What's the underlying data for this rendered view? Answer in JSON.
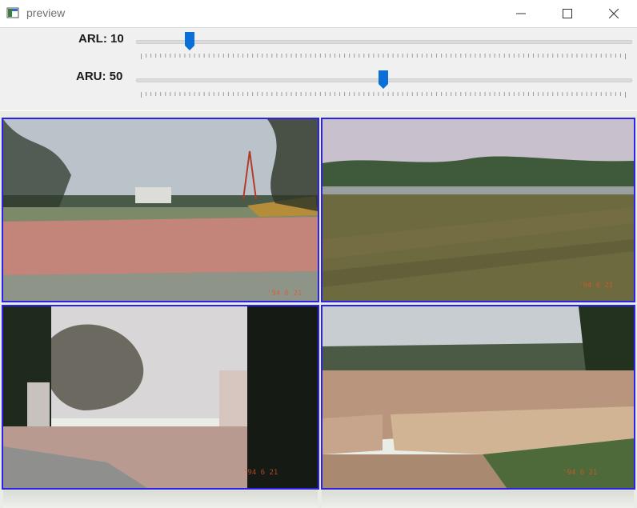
{
  "window": {
    "title": "preview"
  },
  "trackbars": [
    {
      "label": "ARL: 10",
      "value": 10,
      "max": 100
    },
    {
      "label": "ARU: 50",
      "value": 50,
      "max": 100
    }
  ],
  "icons": {
    "app": "app-window-icon",
    "minimize": "minimize-icon",
    "maximize": "maximize-icon",
    "close": "close-icon"
  },
  "colors": {
    "tile_border": "#2b22e6",
    "thumb": "#0a6fd6"
  },
  "photos": [
    {
      "scene": "brick-plaza-with-tower",
      "stamp": "'94 6 21"
    },
    {
      "scene": "grass-field-with-trees",
      "stamp": "'94 6 21"
    },
    {
      "scene": "gate-with-bare-trees",
      "stamp": "'94 6 21"
    },
    {
      "scene": "paved-grid-lot",
      "stamp": "'94 6 21"
    }
  ]
}
